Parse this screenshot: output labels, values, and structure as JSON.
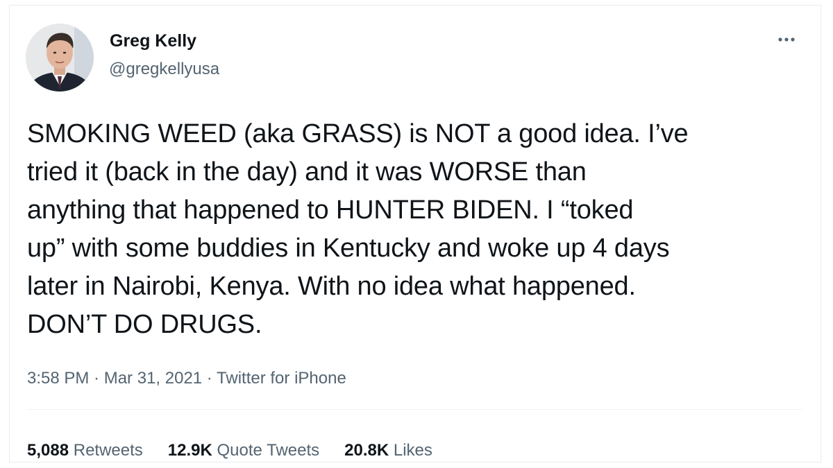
{
  "author": {
    "display_name": "Greg Kelly",
    "handle": "@gregkellyusa"
  },
  "more_icon": "more-horizontal-icon",
  "tweet": {
    "text": "SMOKING WEED (aka GRASS) is NOT a good idea.  I’ve\ntried it (back in the day) and it was WORSE than\nanything that happened to HUNTER BIDEN. I “toked\nup” with some buddies in Kentucky and woke up 4 days\nlater in Nairobi, Kenya.  With no idea what happened.\nDON’T DO DRUGS."
  },
  "meta": {
    "time": "3:58 PM",
    "separator": " · ",
    "date": "Mar 31, 2021",
    "source": "Twitter for iPhone"
  },
  "stats": [
    {
      "count": "5,088",
      "label": "Retweets"
    },
    {
      "count": "12.9K",
      "label": "Quote Tweets"
    },
    {
      "count": "20.8K",
      "label": "Likes"
    }
  ],
  "colors": {
    "text_primary": "#0f1419",
    "text_secondary": "#536471",
    "border": "#e9ecef"
  }
}
